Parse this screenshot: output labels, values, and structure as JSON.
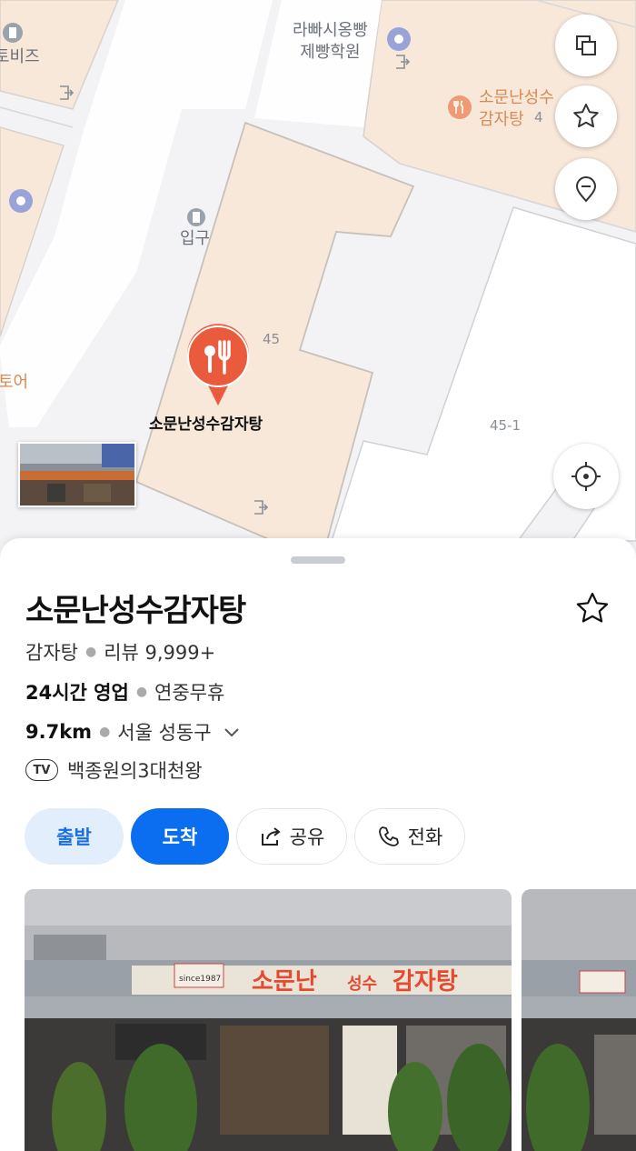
{
  "map": {
    "labels": {
      "bakery": "라빠시옹빵\n제빵학원",
      "restaurant_top": "소문난성수\n감자탕",
      "lot_4": "4",
      "left_biz": "토비즈",
      "entrance": "입구",
      "lot_45": "45",
      "lot_45_1": "45-1",
      "left_store": "토어",
      "marker": "소문난성수감자탕"
    },
    "colors": {
      "building": "#f8e8da",
      "road": "#ffffff",
      "marker": "#ea5a3d",
      "accent": "#0b6ef0"
    }
  },
  "place": {
    "name": "소문난성수감자탕",
    "category": "감자탕",
    "review": "리뷰 9,999+",
    "hours": "24시간 영업",
    "holiday": "연중무휴",
    "distance": "9.7km",
    "district": "서울 성동구",
    "tv_badge": "TV",
    "tv_show": "백종원의3대천왕"
  },
  "actions": {
    "depart": "출발",
    "arrive": "도착",
    "share": "공유",
    "call": "전화"
  },
  "photo": {
    "sign_main": "소문난",
    "sign_sub": "성수",
    "sign_end": "감자탕",
    "badge": "since1987"
  }
}
